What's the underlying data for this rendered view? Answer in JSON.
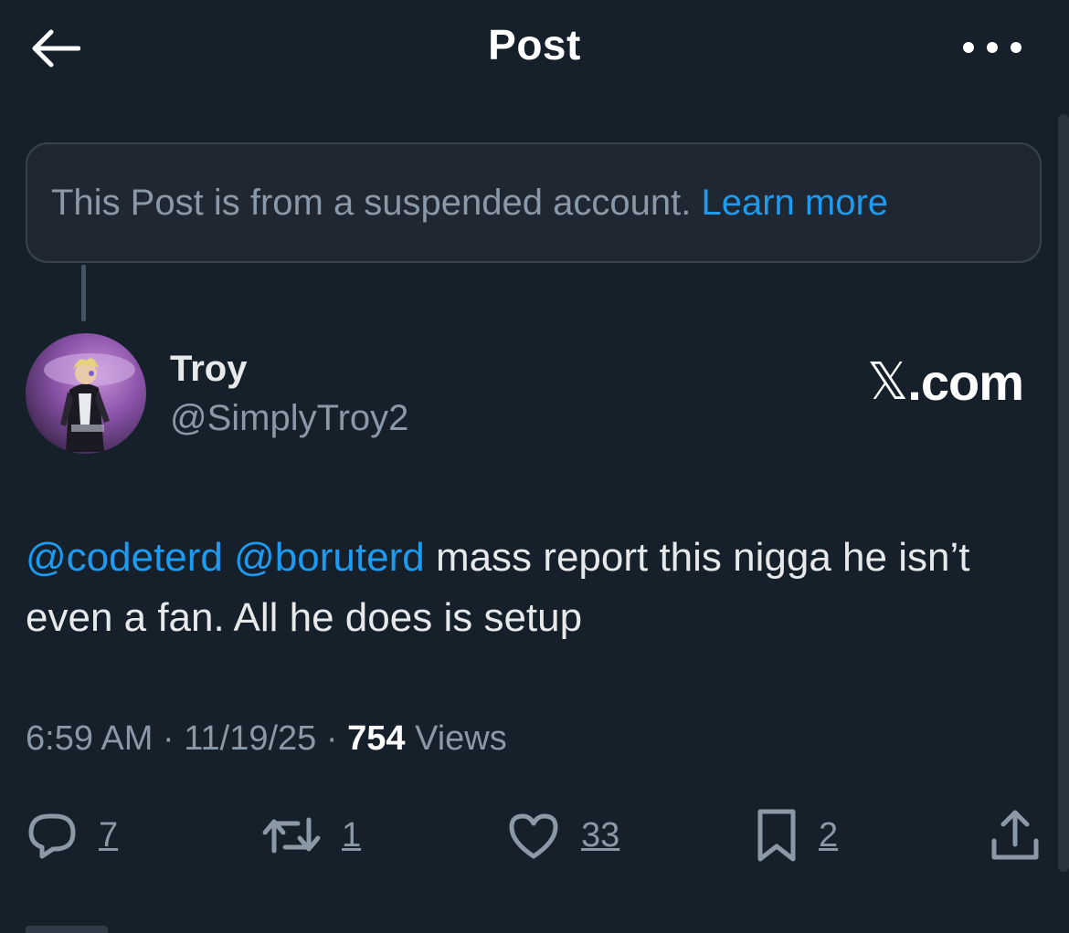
{
  "header": {
    "title": "Post",
    "back_icon": "arrow-left-icon",
    "more_icon": "more-dots-icon"
  },
  "notice": {
    "text": "This Post is from a suspended account.",
    "link_label": "Learn more"
  },
  "post": {
    "author": {
      "display_name": "Troy",
      "handle": "@SimplyTroy2"
    },
    "source_badge": {
      "logo": "𝕏",
      "suffix": ".com"
    },
    "text": {
      "mention_1": "@codeterd",
      "mention_2": "@boruterd",
      "body": "mass report this nigga he isn’t even a fan. All he does is setup"
    },
    "meta": {
      "time": "6:59 AM",
      "separator": "·",
      "date": "11/19/25",
      "views_count": "754",
      "views_label": "Views"
    },
    "actions": {
      "replies": "7",
      "reposts": "1",
      "likes": "33",
      "bookmarks": "2"
    }
  },
  "colors": {
    "background": "#15202b",
    "accent": "#1d9bf0",
    "secondary_text": "#8b98a5",
    "notice_background": "#1e2732",
    "border": "#38444d"
  }
}
